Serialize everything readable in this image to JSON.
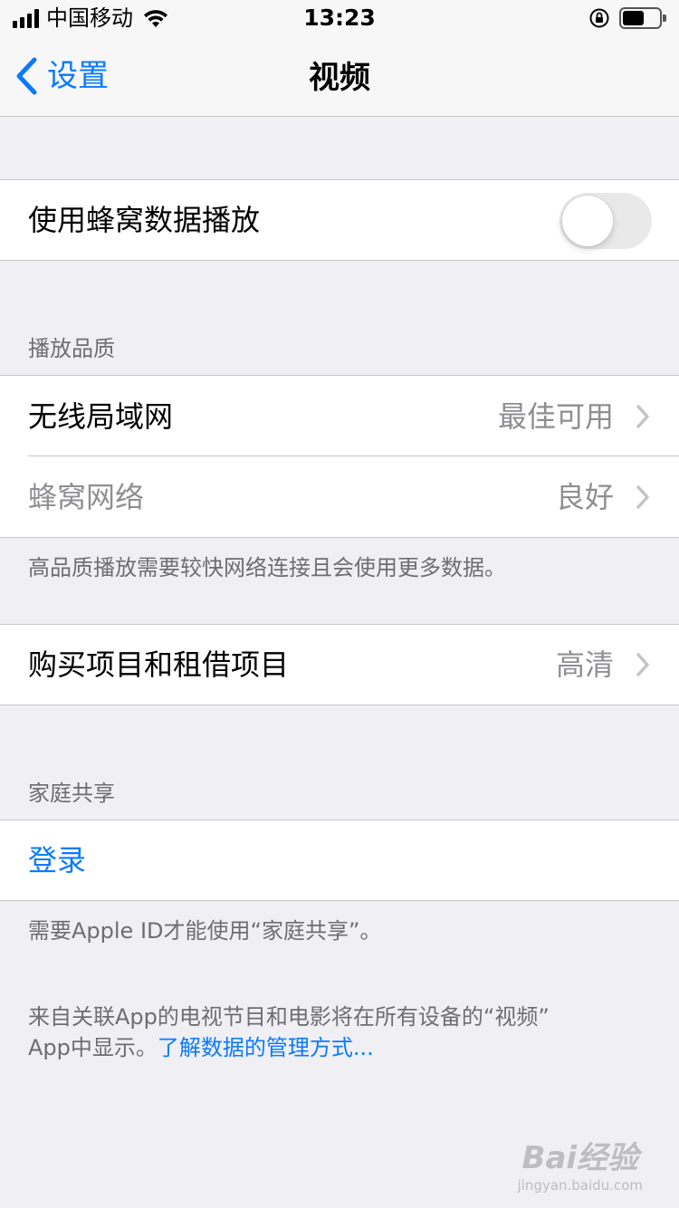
{
  "status_bar": {
    "carrier": "中国移动",
    "time": "13:23",
    "battery_level": 0.6
  },
  "nav": {
    "back_label": "设置",
    "title": "视频"
  },
  "cellular_playback": {
    "label": "使用蜂窝数据播放",
    "enabled": false
  },
  "quality_section": {
    "header": "播放品质",
    "rows": [
      {
        "label": "无线局域网",
        "value": "最佳可用"
      },
      {
        "label": "蜂窝网络",
        "value": "良好"
      }
    ],
    "footer": "高品质播放需要较快网络连接且会使用更多数据。"
  },
  "purchases": {
    "label": "购买项目和租借项目",
    "value": "高清"
  },
  "family_sharing": {
    "header": "家庭共享",
    "signin_label": "登录",
    "footer": "需要Apple ID才能使用“家庭共享”。"
  },
  "bottom_note": {
    "line1": "来自关联App的电视节目和电影将在所有设备的“视频”",
    "line2_prefix": "App中显示。",
    "link": "了解数据的管理方式..."
  },
  "watermark": {
    "brand": "Bai经验",
    "sub": "jingyan.baidu.com"
  }
}
